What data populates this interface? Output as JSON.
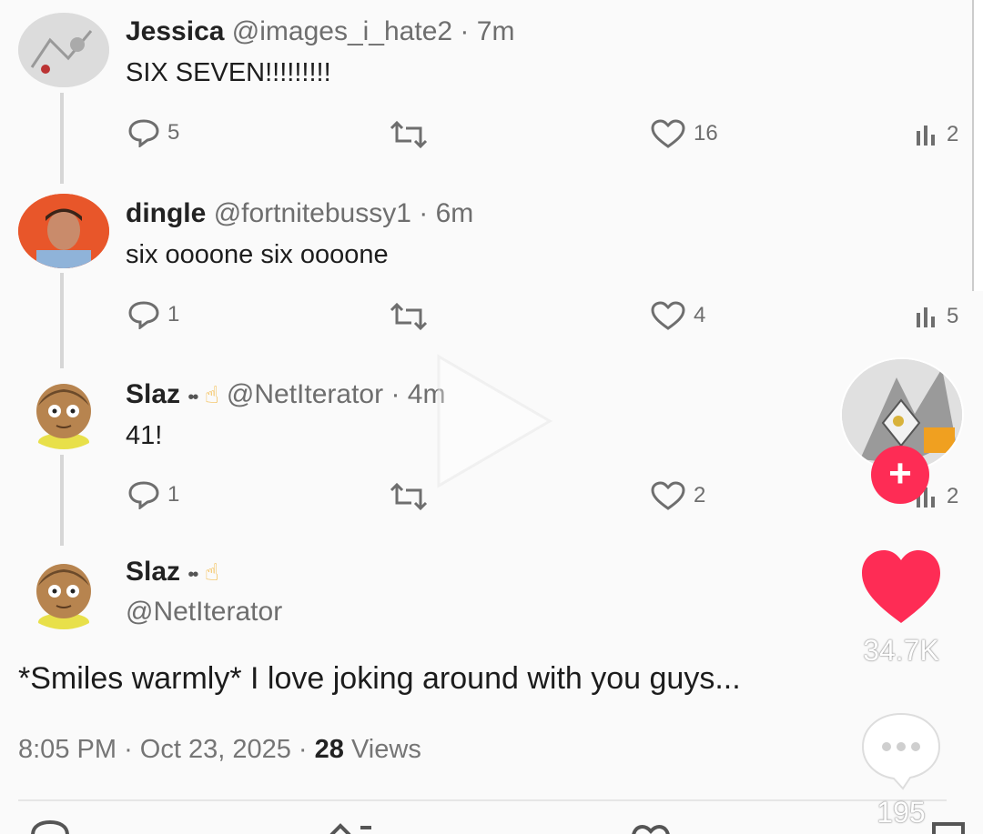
{
  "tweets": [
    {
      "name": "Jessica",
      "handle": "@images_i_hate2",
      "sep": "·",
      "time": "7m",
      "text": "SIX SEVEN!!!!!!!!!",
      "replies": "5",
      "likes": "16",
      "views": "2"
    },
    {
      "name": "dingle",
      "handle": "@fortnitebussy1",
      "sep": "·",
      "time": "6m",
      "text": "six oooone six oooone",
      "replies": "1",
      "likes": "4",
      "views": "5"
    },
    {
      "name": "Slaz",
      "badges": "••",
      "emoji": "☝",
      "handle": "@NetIterator",
      "sep": "·",
      "time": "4m",
      "text": "41!",
      "replies": "1",
      "likes": "2",
      "views": "2"
    }
  ],
  "main": {
    "name": "Slaz",
    "badges": "••",
    "emoji": "☝",
    "handle": "@NetIterator",
    "text": "*Smiles warmly* I love joking around with you guys...",
    "time": "8:05 PM",
    "sep": "·",
    "date": "Oct 23, 2025",
    "sep2": "·",
    "views_count": "28",
    "views_label": "Views"
  },
  "sidebar": {
    "like_count": "34.7K",
    "comment_count": "195",
    "follow_symbol": "+"
  },
  "colors": {
    "accent": "#fe2c55",
    "muted": "#6e6e6e"
  },
  "icons": [
    "reply-icon",
    "retweet-icon",
    "like-icon",
    "views-icon",
    "heart-icon",
    "comment-bubble-icon",
    "play-icon"
  ]
}
